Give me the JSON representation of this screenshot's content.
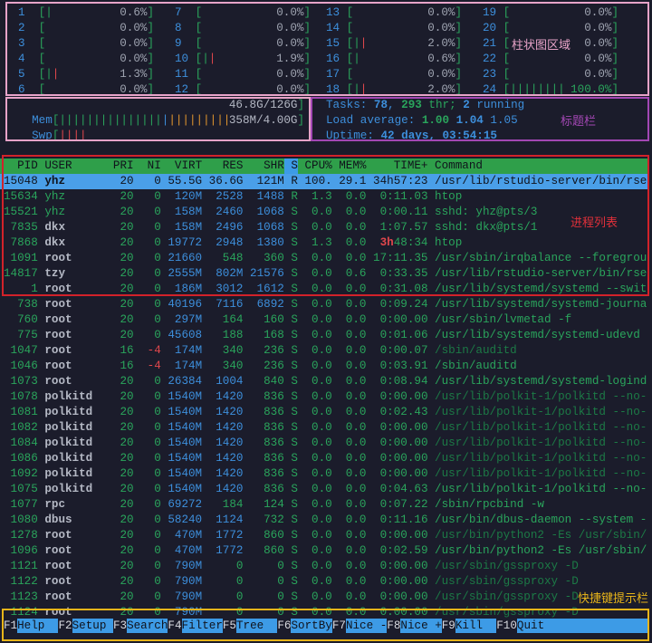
{
  "cpu_meters": [
    {
      "label": "1",
      "value": "0.6%",
      "normal": 1,
      "kernel": 0
    },
    {
      "label": "2",
      "value": "0.0%",
      "normal": 0,
      "kernel": 0
    },
    {
      "label": "3",
      "value": "0.0%",
      "normal": 0,
      "kernel": 0
    },
    {
      "label": "4",
      "value": "0.0%",
      "normal": 0,
      "kernel": 0
    },
    {
      "label": "5",
      "value": "1.3%",
      "normal": 1,
      "kernel": 1
    },
    {
      "label": "6",
      "value": "0.0%",
      "normal": 0,
      "kernel": 0
    },
    {
      "label": "7",
      "value": "0.0%",
      "normal": 0,
      "kernel": 0
    },
    {
      "label": "8",
      "value": "0.0%",
      "normal": 0,
      "kernel": 0
    },
    {
      "label": "9",
      "value": "0.0%",
      "normal": 0,
      "kernel": 0
    },
    {
      "label": "10",
      "value": "1.9%",
      "normal": 1,
      "kernel": 1
    },
    {
      "label": "11",
      "value": "0.0%",
      "normal": 0,
      "kernel": 0
    },
    {
      "label": "12",
      "value": "0.0%",
      "normal": 0,
      "kernel": 0
    },
    {
      "label": "13",
      "value": "0.0%",
      "normal": 0,
      "kernel": 0
    },
    {
      "label": "14",
      "value": "0.0%",
      "normal": 0,
      "kernel": 0
    },
    {
      "label": "15",
      "value": "2.0%",
      "normal": 1,
      "kernel": 1
    },
    {
      "label": "16",
      "value": "0.6%",
      "normal": 1,
      "kernel": 0
    },
    {
      "label": "17",
      "value": "0.0%",
      "normal": 0,
      "kernel": 0
    },
    {
      "label": "18",
      "value": "2.0%",
      "normal": 1,
      "kernel": 1
    },
    {
      "label": "19",
      "value": "0.0%",
      "normal": 0,
      "kernel": 0
    },
    {
      "label": "20",
      "value": "0.0%",
      "normal": 0,
      "kernel": 0
    },
    {
      "label": "21",
      "value": "0.0%",
      "normal": 0,
      "kernel": 0
    },
    {
      "label": "22",
      "value": "0.0%",
      "normal": 0,
      "kernel": 0
    },
    {
      "label": "23",
      "value": "0.0%",
      "normal": 0,
      "kernel": 0
    },
    {
      "label": "24",
      "value": "100.0%",
      "normal": 8,
      "kernel": 0
    }
  ],
  "memory": {
    "mem_label": "Mem",
    "mem_value": "46.8G/126G",
    "mem_used_bars": 15,
    "mem_buffer_bars": 1,
    "mem_cache_bars": 9,
    "swp_label": "Swp",
    "swp_value": "358M/4.00G",
    "swp_bars": 4
  },
  "summary": {
    "tasks_label": "Tasks: ",
    "tasks": "78",
    "sep1": ", ",
    "threads": "293",
    "thr_label": " thr; ",
    "running": "2",
    "running_label": " running",
    "load_label": "Load average: ",
    "load1": "1.00",
    "load5": "1.04",
    "load15": "1.05",
    "uptime_label": "Uptime: ",
    "uptime": "42 days, 03:54:15"
  },
  "columns": [
    "PID",
    "USER",
    "PRI",
    "NI",
    "VIRT",
    "RES",
    "SHR",
    "S",
    "CPU%",
    "MEM%",
    "TIME+",
    "Command"
  ],
  "processes": [
    {
      "v": [
        "15048",
        "yhz",
        "20",
        "0",
        "55.5G",
        "36.6G",
        "121M",
        "R",
        "100.",
        "29.1",
        "34h57:23",
        "/usr/lib/rstudio-server/bin/rse"
      ],
      "selected": true
    },
    {
      "v": [
        "15634",
        "yhz",
        "20",
        "0",
        "120M",
        "2528",
        "1488",
        "R",
        "1.3",
        "0.0",
        "0:11.03",
        "htop"
      ],
      "own": true
    },
    {
      "v": [
        "15521",
        "yhz",
        "20",
        "0",
        "158M",
        "2460",
        "1068",
        "S",
        "0.0",
        "0.0",
        "0:00.11",
        "sshd: yhz@pts/3"
      ],
      "own": true
    },
    {
      "v": [
        "7835",
        "dkx",
        "20",
        "0",
        "158M",
        "2496",
        "1068",
        "S",
        "0.0",
        "0.0",
        "1:07.57",
        "sshd: dkx@pts/1"
      ]
    },
    {
      "v": [
        "7868",
        "dkx",
        "20",
        "0",
        "19772",
        "2948",
        "1380",
        "S",
        "1.3",
        "0.0",
        "3h48:34",
        "htop"
      ]
    },
    {
      "v": [
        "1091",
        "root",
        "20",
        "0",
        "21660",
        "548",
        "360",
        "S",
        "0.0",
        "0.0",
        "17:11.35",
        "/usr/sbin/irqbalance --foregrou"
      ]
    },
    {
      "v": [
        "14817",
        "tzy",
        "20",
        "0",
        "2555M",
        "802M",
        "21576",
        "S",
        "0.0",
        "0.6",
        "0:33.35",
        "/usr/lib/rstudio-server/bin/rse"
      ]
    },
    {
      "v": [
        "1",
        "root",
        "20",
        "0",
        "186M",
        "3012",
        "1612",
        "S",
        "0.0",
        "0.0",
        "0:31.08",
        "/usr/lib/systemd/systemd --swit"
      ]
    },
    {
      "v": [
        "738",
        "root",
        "20",
        "0",
        "40196",
        "7116",
        "6892",
        "S",
        "0.0",
        "0.0",
        "0:09.24",
        "/usr/lib/systemd/systemd-journa"
      ]
    },
    {
      "v": [
        "760",
        "root",
        "20",
        "0",
        "297M",
        "164",
        "160",
        "S",
        "0.0",
        "0.0",
        "0:00.00",
        "/usr/sbin/lvmetad -f"
      ]
    },
    {
      "v": [
        "775",
        "root",
        "20",
        "0",
        "45608",
        "188",
        "168",
        "S",
        "0.0",
        "0.0",
        "0:01.06",
        "/usr/lib/systemd/systemd-udevd"
      ]
    },
    {
      "v": [
        "1047",
        "root",
        "16",
        "-4",
        "174M",
        "340",
        "236",
        "S",
        "0.0",
        "0.0",
        "0:00.07",
        "/sbin/auditd"
      ],
      "thread": true
    },
    {
      "v": [
        "1046",
        "root",
        "16",
        "-4",
        "174M",
        "340",
        "236",
        "S",
        "0.0",
        "0.0",
        "0:03.91",
        "/sbin/auditd"
      ]
    },
    {
      "v": [
        "1073",
        "root",
        "20",
        "0",
        "26384",
        "1004",
        "840",
        "S",
        "0.0",
        "0.0",
        "0:08.94",
        "/usr/lib/systemd/systemd-logind"
      ]
    },
    {
      "v": [
        "1078",
        "polkitd",
        "20",
        "0",
        "1540M",
        "1420",
        "836",
        "S",
        "0.0",
        "0.0",
        "0:00.00",
        "/usr/lib/polkit-1/polkitd --no-"
      ],
      "thread": true
    },
    {
      "v": [
        "1081",
        "polkitd",
        "20",
        "0",
        "1540M",
        "1420",
        "836",
        "S",
        "0.0",
        "0.0",
        "0:02.43",
        "/usr/lib/polkit-1/polkitd --no-"
      ],
      "thread": true
    },
    {
      "v": [
        "1082",
        "polkitd",
        "20",
        "0",
        "1540M",
        "1420",
        "836",
        "S",
        "0.0",
        "0.0",
        "0:00.00",
        "/usr/lib/polkit-1/polkitd --no-"
      ],
      "thread": true
    },
    {
      "v": [
        "1084",
        "polkitd",
        "20",
        "0",
        "1540M",
        "1420",
        "836",
        "S",
        "0.0",
        "0.0",
        "0:00.00",
        "/usr/lib/polkit-1/polkitd --no-"
      ],
      "thread": true
    },
    {
      "v": [
        "1086",
        "polkitd",
        "20",
        "0",
        "1540M",
        "1420",
        "836",
        "S",
        "0.0",
        "0.0",
        "0:00.00",
        "/usr/lib/polkit-1/polkitd --no-"
      ],
      "thread": true
    },
    {
      "v": [
        "1092",
        "polkitd",
        "20",
        "0",
        "1540M",
        "1420",
        "836",
        "S",
        "0.0",
        "0.0",
        "0:00.00",
        "/usr/lib/polkit-1/polkitd --no-"
      ],
      "thread": true
    },
    {
      "v": [
        "1075",
        "polkitd",
        "20",
        "0",
        "1540M",
        "1420",
        "836",
        "S",
        "0.0",
        "0.0",
        "0:04.63",
        "/usr/lib/polkit-1/polkitd --no-"
      ]
    },
    {
      "v": [
        "1077",
        "rpc",
        "20",
        "0",
        "69272",
        "184",
        "124",
        "S",
        "0.0",
        "0.0",
        "0:07.22",
        "/sbin/rpcbind -w"
      ]
    },
    {
      "v": [
        "1080",
        "dbus",
        "20",
        "0",
        "58240",
        "1124",
        "732",
        "S",
        "0.0",
        "0.0",
        "0:11.16",
        "/usr/bin/dbus-daemon --system -"
      ]
    },
    {
      "v": [
        "1278",
        "root",
        "20",
        "0",
        "470M",
        "1772",
        "860",
        "S",
        "0.0",
        "0.0",
        "0:00.00",
        "/usr/bin/python2 -Es /usr/sbin/"
      ],
      "thread": true
    },
    {
      "v": [
        "1096",
        "root",
        "20",
        "0",
        "470M",
        "1772",
        "860",
        "S",
        "0.0",
        "0.0",
        "0:02.59",
        "/usr/bin/python2 -Es /usr/sbin/"
      ]
    },
    {
      "v": [
        "1121",
        "root",
        "20",
        "0",
        "790M",
        "0",
        "0",
        "S",
        "0.0",
        "0.0",
        "0:00.00",
        "/usr/sbin/gssproxy -D"
      ],
      "thread": true
    },
    {
      "v": [
        "1122",
        "root",
        "20",
        "0",
        "790M",
        "0",
        "0",
        "S",
        "0.0",
        "0.0",
        "0:00.00",
        "/usr/sbin/gssproxy -D"
      ],
      "thread": true
    },
    {
      "v": [
        "1123",
        "root",
        "20",
        "0",
        "790M",
        "0",
        "0",
        "S",
        "0.0",
        "0.0",
        "0:00.00",
        "/usr/sbin/gssproxy -D"
      ],
      "thread": true
    },
    {
      "v": [
        "1124",
        "root",
        "20",
        "0",
        "790M",
        "0",
        "0",
        "S",
        "0.0",
        "0.0",
        "0:00.00",
        "/usr/sbin/gssproxy -D"
      ],
      "thread": true
    }
  ],
  "function_bar": [
    {
      "key": "F1",
      "label": "Help"
    },
    {
      "key": "F2",
      "label": "Setup"
    },
    {
      "key": "F3",
      "label": "Search"
    },
    {
      "key": "F4",
      "label": "Filter"
    },
    {
      "key": "F5",
      "label": "Tree"
    },
    {
      "key": "F6",
      "label": "SortBy"
    },
    {
      "key": "F7",
      "label": "Nice -"
    },
    {
      "key": "F8",
      "label": "Nice +"
    },
    {
      "key": "F9",
      "label": "Kill"
    },
    {
      "key": "F10",
      "label": "Quit"
    }
  ],
  "annotations": {
    "meters": "柱状图区域",
    "header": "标题栏",
    "process_list": "进程列表",
    "function_bar": "快捷键提示栏",
    "colors": {
      "meters": "#e7a3c8",
      "header": "#a347b4",
      "process_list": "#d2222a",
      "function_bar": "#e8b51a"
    }
  }
}
